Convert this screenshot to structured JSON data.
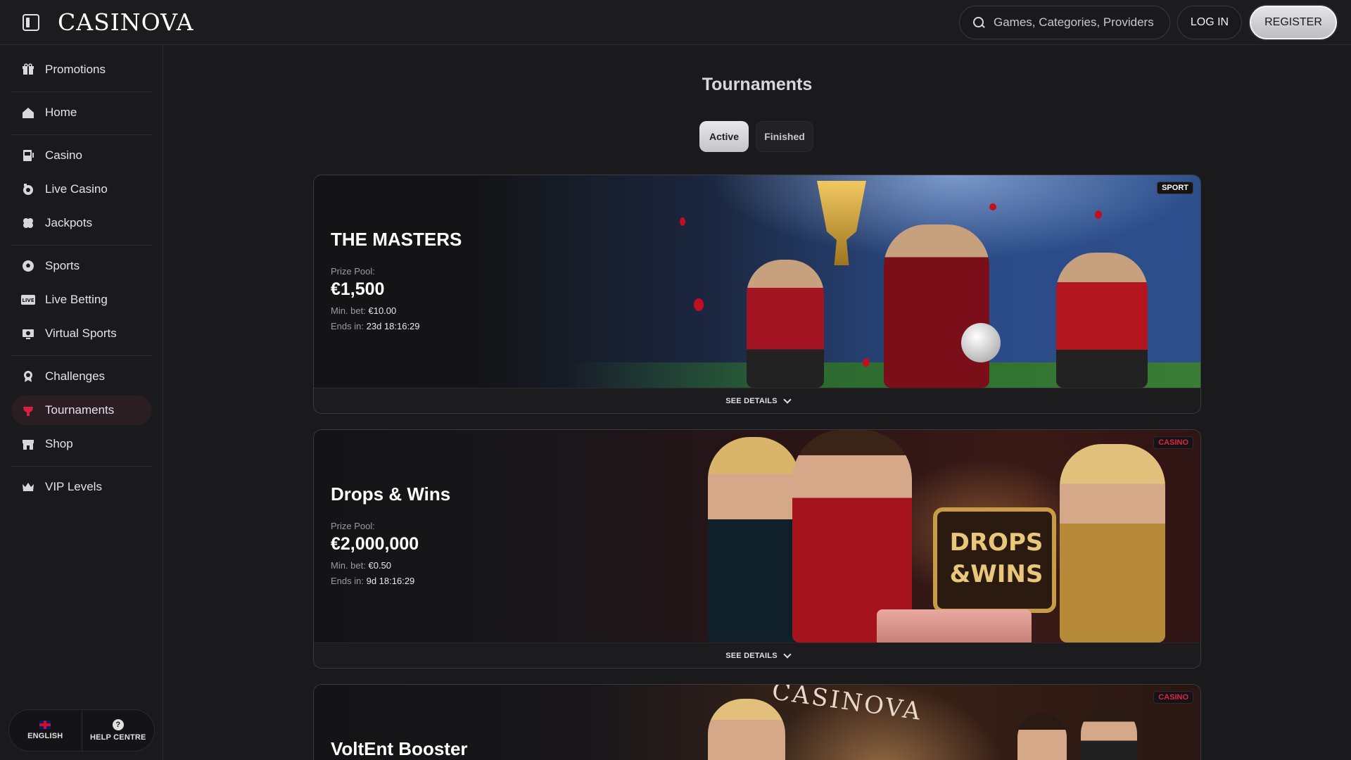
{
  "header": {
    "logo_text": "CASINOVA",
    "search_placeholder": "Games, Categories, Providers",
    "login_label": "LOG IN",
    "register_label": "REGISTER"
  },
  "sidebar": {
    "items": [
      {
        "label": "Promotions",
        "icon": "gift-icon"
      },
      {
        "label": "Home",
        "icon": "home-icon"
      },
      {
        "label": "Casino",
        "icon": "slot-machine-icon"
      },
      {
        "label": "Live Casino",
        "icon": "live-casino-icon"
      },
      {
        "label": "Jackpots",
        "icon": "clover-icon"
      },
      {
        "label": "Sports",
        "icon": "soccer-ball-icon"
      },
      {
        "label": "Live Betting",
        "icon": "live-badge-icon"
      },
      {
        "label": "Virtual Sports",
        "icon": "virtual-sports-icon"
      },
      {
        "label": "Challenges",
        "icon": "award-icon"
      },
      {
        "label": "Tournaments",
        "icon": "tournament-icon",
        "active": true
      },
      {
        "label": "Shop",
        "icon": "shop-icon"
      },
      {
        "label": "VIP Levels",
        "icon": "crown-icon"
      }
    ],
    "footer": {
      "language_label": "ENGLISH",
      "help_label": "HELP CENTRE"
    }
  },
  "main": {
    "title": "Tournaments",
    "tabs": [
      {
        "label": "Active",
        "selected": true
      },
      {
        "label": "Finished",
        "selected": false
      }
    ],
    "cards": [
      {
        "title": "THE MASTERS",
        "badge": "SPORT",
        "prize_label": "Prize Pool:",
        "prize": "€1,500",
        "min_bet_label": "Min. bet:",
        "min_bet": "€10.00",
        "ends_label": "Ends in:",
        "ends": "23d 18:16:29",
        "details_label": "SEE DETAILS"
      },
      {
        "title": "Drops & Wins",
        "badge": "CASINO",
        "prize_label": "Prize Pool:",
        "prize": "€2,000,000",
        "min_bet_label": "Min. bet:",
        "min_bet": "€0.50",
        "ends_label": "Ends in:",
        "ends": "9d 18:16:29",
        "details_label": "SEE DETAILS"
      },
      {
        "title": "VoltEnt Booster",
        "badge": "CASINO"
      }
    ]
  },
  "colors": {
    "accent_red": "#d4213d",
    "background": "#1a1a1c",
    "active_nav_bg": "#2b1e22"
  }
}
